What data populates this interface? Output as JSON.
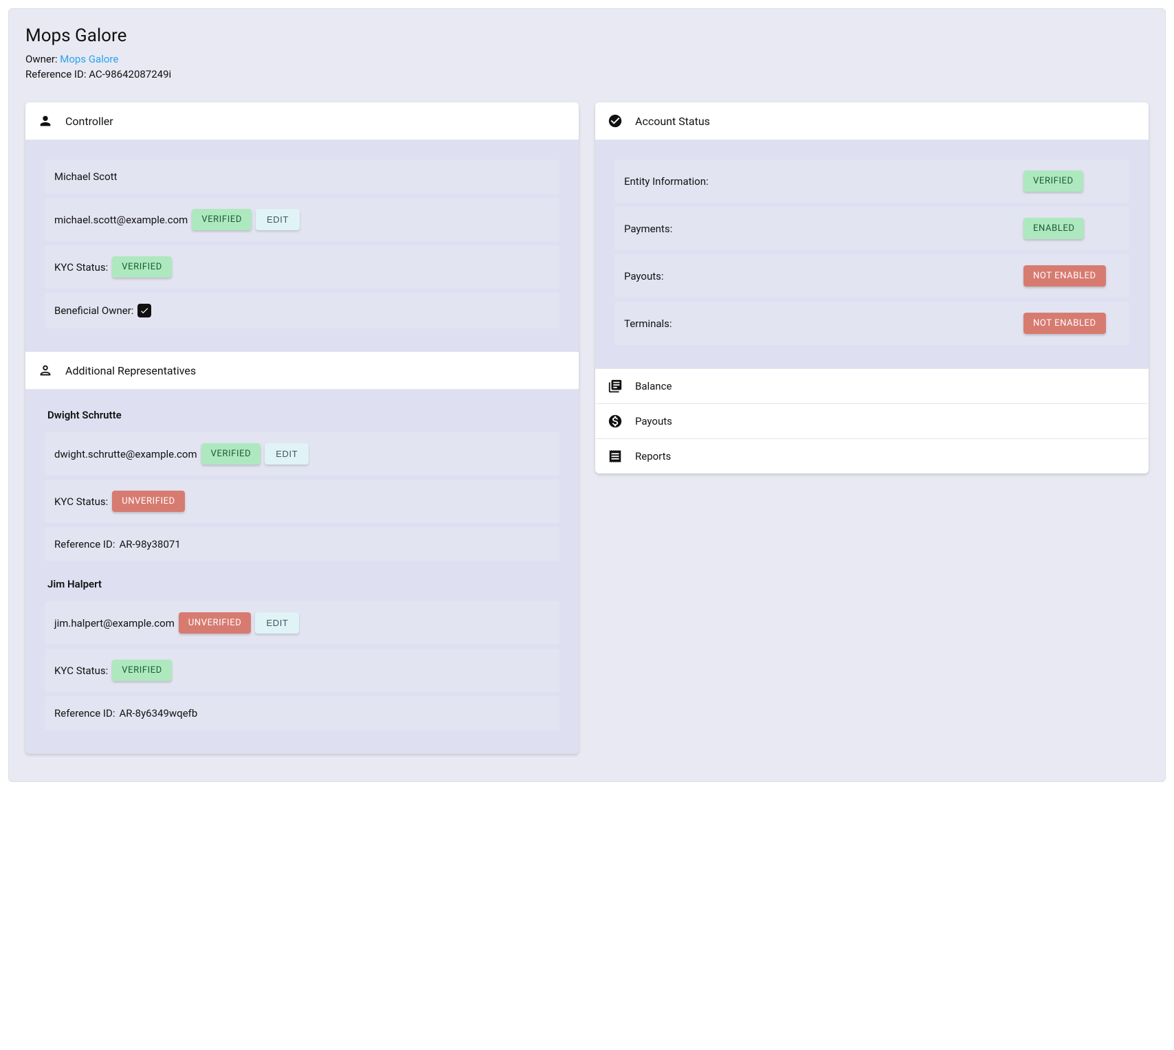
{
  "header": {
    "title": "Mops Galore",
    "owner_label": "Owner: ",
    "owner_link": "Mops Galore",
    "reference_label": "Reference ID: ",
    "reference_value": "AC-98642087249i"
  },
  "controller": {
    "section_label": "Controller",
    "name": "Michael Scott",
    "email": "michael.scott@example.com",
    "email_status": "VERIFIED",
    "edit_label": "EDIT",
    "kyc_label": "KYC Status:",
    "kyc_status": "VERIFIED",
    "beneficial_label": "Beneficial Owner:"
  },
  "additional": {
    "section_label": "Additional Representatives",
    "reps": [
      {
        "name": "Dwight Schrutte",
        "email": "dwight.schrutte@example.com",
        "email_status": "VERIFIED",
        "email_status_kind": "green",
        "edit_label": "EDIT",
        "kyc_label": "KYC Status:",
        "kyc_status": "UNVERIFIED",
        "kyc_status_kind": "red",
        "ref_label": "Reference ID: ",
        "ref_value": "AR-98y38071"
      },
      {
        "name": "Jim Halpert",
        "email": "jim.halpert@example.com",
        "email_status": "UNVERIFIED",
        "email_status_kind": "red",
        "edit_label": "EDIT",
        "kyc_label": "KYC Status:",
        "kyc_status": "VERIFIED",
        "kyc_status_kind": "green",
        "ref_label": "Reference ID: ",
        "ref_value": "AR-8y6349wqefb"
      }
    ]
  },
  "account_status": {
    "section_label": "Account Status",
    "rows": [
      {
        "label": "Entity Information:",
        "status": "VERIFIED",
        "kind": "green"
      },
      {
        "label": "Payments:",
        "status": "ENABLED",
        "kind": "green"
      },
      {
        "label": "Payouts:",
        "status": "NOT ENABLED",
        "kind": "red"
      },
      {
        "label": "Terminals:",
        "status": "NOT ENABLED",
        "kind": "red"
      }
    ],
    "accordion": [
      {
        "label": "Balance"
      },
      {
        "label": "Payouts"
      },
      {
        "label": "Reports"
      }
    ]
  }
}
